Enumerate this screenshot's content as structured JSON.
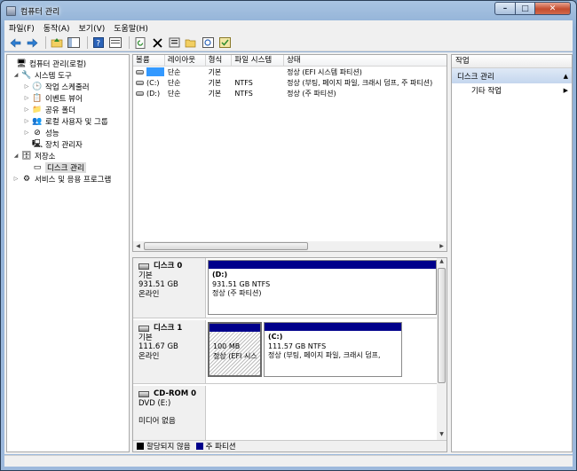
{
  "window": {
    "title": "컴퓨터 관리"
  },
  "caption": {
    "minimize": "–",
    "maximize": "□",
    "close": "✕"
  },
  "menu": [
    "파일(F)",
    "동작(A)",
    "보기(V)",
    "도움말(H)"
  ],
  "toolbar": [
    "back-icon",
    "forward-icon",
    "up-icon",
    "show-hide-tree-icon",
    "help-icon",
    "console-icon",
    "refresh-icon",
    "delete-icon",
    "properties-icon",
    "open-icon",
    "search-icon",
    "check-icon"
  ],
  "tree": {
    "root": "컴퓨터 관리(로컬)",
    "system_tools": "시스템 도구",
    "task_scheduler": "작업 스케줄러",
    "event_viewer": "이벤트 뷰어",
    "shared_folders": "공유 폴더",
    "local_users": "로컬 사용자 및 그룹",
    "performance": "성능",
    "device_manager": "장치 관리자",
    "storage": "저장소",
    "disk_management": "디스크 관리",
    "services": "서비스 및 응용 프로그램"
  },
  "volume_list": {
    "columns": [
      "볼륨",
      "레이아웃",
      "형식",
      "파일 시스템",
      "상태"
    ],
    "rows": [
      [
        "",
        "단순",
        "기본",
        "",
        "정상 (EFI 시스템 파티션)"
      ],
      [
        "(C:)",
        "단순",
        "기본",
        "NTFS",
        "정상 (부팅, 페이지 파일, 크래시 덤프, 주 파티션)"
      ],
      [
        "(D:)",
        "단순",
        "기본",
        "NTFS",
        "정상 (주 파티션)"
      ]
    ]
  },
  "disks": [
    {
      "name": "디스크 0",
      "type": "기본",
      "size": "931.51 GB",
      "status": "온라인",
      "partitions": [
        {
          "label": "(D:)",
          "size": "931.51 GB NTFS",
          "status": "정상 (주 파티션)"
        }
      ]
    },
    {
      "name": "디스크 1",
      "type": "기본",
      "size": "111.67 GB",
      "status": "온라인",
      "partitions": [
        {
          "label": "",
          "size": "100 MB",
          "status": "정상 (EFI 시스"
        },
        {
          "label": "(C:)",
          "size": "111.57 GB NTFS",
          "status": "정상 (부팅, 페이지 파일, 크래시 덤프,"
        }
      ]
    },
    {
      "name": "CD-ROM 0",
      "type": "DVD (E:)",
      "size": "",
      "status": "미디어 없음",
      "partitions": []
    }
  ],
  "legend": {
    "unallocated": "할당되지 않음",
    "primary": "주 파티션"
  },
  "actions": {
    "header": "작업",
    "section": "디스크 관리",
    "more": "기타 작업"
  },
  "colors": {
    "primary_partition": "#00008b",
    "unallocated": "#000000",
    "action_section": "#c4d6ee"
  }
}
